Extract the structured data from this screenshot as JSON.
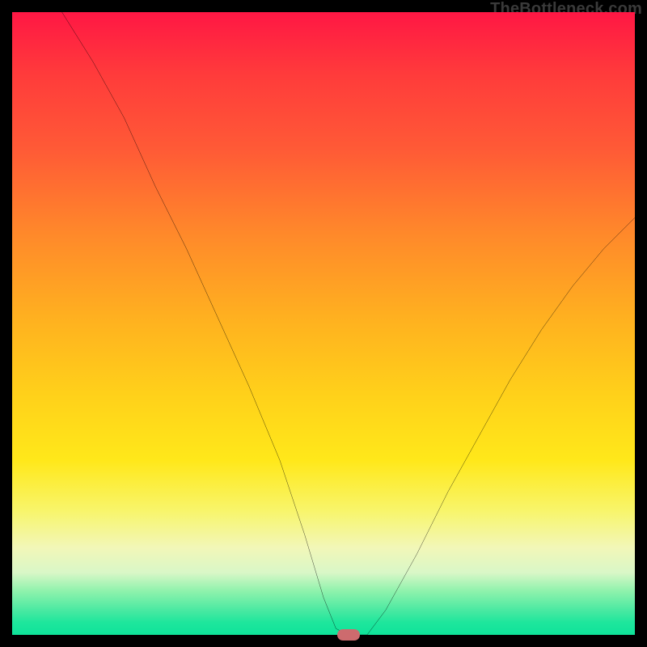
{
  "watermark": "TheBottleneck.com",
  "chart_data": {
    "type": "line",
    "title": "",
    "xlabel": "",
    "ylabel": "",
    "xlim": [
      0,
      100
    ],
    "ylim": [
      0,
      100
    ],
    "grid": false,
    "legend": false,
    "marker": {
      "x": 54,
      "y": 0,
      "color": "#cd6b6e"
    },
    "series": [
      {
        "name": "bottleneck-curve",
        "color": "#000000",
        "points": [
          {
            "x": 8,
            "y": 100
          },
          {
            "x": 13,
            "y": 92
          },
          {
            "x": 18,
            "y": 83
          },
          {
            "x": 23,
            "y": 72
          },
          {
            "x": 28,
            "y": 62
          },
          {
            "x": 33,
            "y": 51
          },
          {
            "x": 38,
            "y": 40
          },
          {
            "x": 43,
            "y": 28
          },
          {
            "x": 47,
            "y": 16
          },
          {
            "x": 50,
            "y": 6
          },
          {
            "x": 52,
            "y": 1
          },
          {
            "x": 54,
            "y": 0
          },
          {
            "x": 57,
            "y": 0
          },
          {
            "x": 60,
            "y": 4
          },
          {
            "x": 65,
            "y": 13
          },
          {
            "x": 70,
            "y": 23
          },
          {
            "x": 75,
            "y": 32
          },
          {
            "x": 80,
            "y": 41
          },
          {
            "x": 85,
            "y": 49
          },
          {
            "x": 90,
            "y": 56
          },
          {
            "x": 95,
            "y": 62
          },
          {
            "x": 100,
            "y": 67
          }
        ]
      }
    ],
    "gradient_stops": [
      {
        "pos": 0,
        "color": "#ff1744"
      },
      {
        "pos": 10,
        "color": "#ff3b3b"
      },
      {
        "pos": 22,
        "color": "#ff5a36"
      },
      {
        "pos": 36,
        "color": "#ff8a2a"
      },
      {
        "pos": 50,
        "color": "#ffb31f"
      },
      {
        "pos": 62,
        "color": "#ffd21a"
      },
      {
        "pos": 72,
        "color": "#ffe81a"
      },
      {
        "pos": 80,
        "color": "#f8f56a"
      },
      {
        "pos": 86,
        "color": "#f2f7b8"
      },
      {
        "pos": 90,
        "color": "#d9f7c7"
      },
      {
        "pos": 93,
        "color": "#8ef2ac"
      },
      {
        "pos": 96,
        "color": "#4be9a2"
      },
      {
        "pos": 98,
        "color": "#1ee69c"
      },
      {
        "pos": 100,
        "color": "#0fe39a"
      }
    ]
  }
}
